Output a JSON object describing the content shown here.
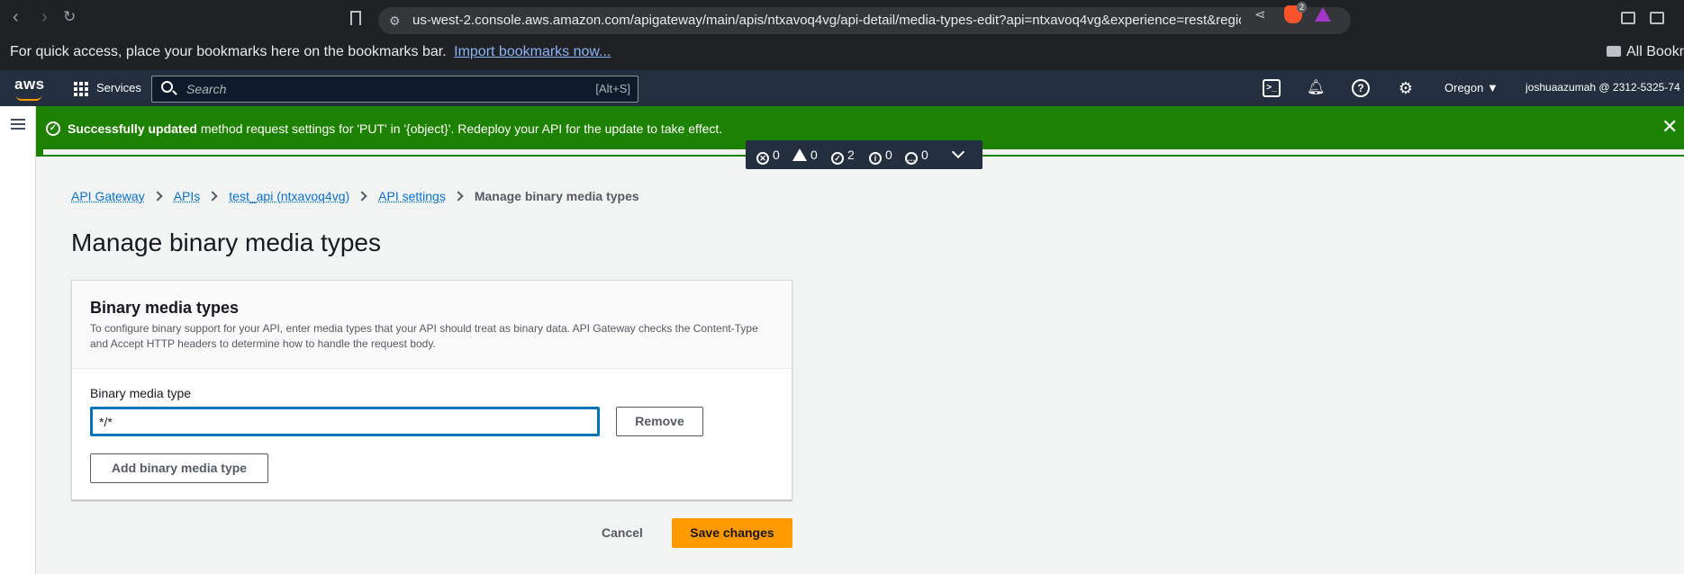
{
  "browser": {
    "url": "us-west-2.console.aws.amazon.com/apigateway/main/apis/ntxavoq4vg/api-detail/media-types-edit?api=ntxavoq4vg&experience=rest&region=u...",
    "brave_badge": "2",
    "bookmarks_message": "For quick access, place your bookmarks here on the bookmarks bar.",
    "import_link": "Import bookmarks now...",
    "all_bookmarks": "All Bookm"
  },
  "aws_nav": {
    "logo": "aws",
    "services": "Services",
    "search_placeholder": "Search",
    "search_shortcut": "[Alt+S]",
    "region": "Oregon ▼",
    "account": "joshuaazumah @ 2312-5325-74"
  },
  "flash": {
    "bold": "Successfully updated",
    "message": " method request settings for 'PUT' in '{object}'. Redeploy your API for the update to take effect.",
    "counters": {
      "errors": "0",
      "warnings": "0",
      "success": "2",
      "info": "0",
      "in_progress": "0"
    }
  },
  "breadcrumb": {
    "items": [
      "API Gateway",
      "APIs",
      "test_api (ntxavoq4vg)",
      "API settings"
    ],
    "current": "Manage binary media types"
  },
  "page": {
    "title": "Manage binary media types",
    "section_title": "Binary media types",
    "section_description": "To configure binary support for your API, enter media types that your API should treat as binary data. API Gateway checks the Content-Type and Accept HTTP headers to determine how to handle the request body.",
    "field_label": "Binary media type",
    "field_value": "*/*",
    "remove_label": "Remove",
    "add_label": "Add binary media type",
    "cancel_label": "Cancel",
    "save_label": "Save changes"
  },
  "colors": {
    "success_green": "#1d8102",
    "aws_orange": "#ff9900",
    "nav_dark": "#232f3e",
    "link_blue": "#0972d3"
  }
}
